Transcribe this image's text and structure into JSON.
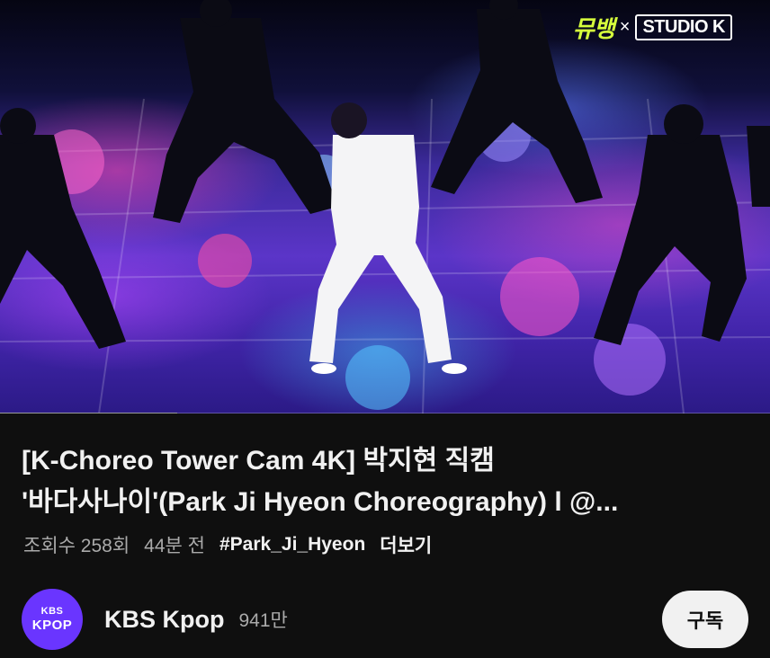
{
  "video": {
    "watermark_show": "뮤뱅",
    "watermark_separator": "×",
    "watermark_brand": "STUDIO K",
    "progress": 0.23
  },
  "title": {
    "line1": "[K-Choreo Tower Cam 4K] 박지현 직캠",
    "line2": "'바다사나이'(Park Ji Hyeon  Choreography) l @..."
  },
  "meta": {
    "views": "조회수 258회",
    "time": "44분 전",
    "hashtag": "#Park_Ji_Hyeon",
    "more": "더보기"
  },
  "channel": {
    "avatar_line1": "KBS",
    "avatar_line2": "KPOP",
    "name": "KBS Kpop",
    "subscribers": "941만",
    "subscribe_label": "구독"
  },
  "colors": {
    "background": "#0f0f0f",
    "avatar": "#6a35ff",
    "subscribe_bg": "#f1f1f1",
    "secondary_text": "#aaaaaa"
  }
}
